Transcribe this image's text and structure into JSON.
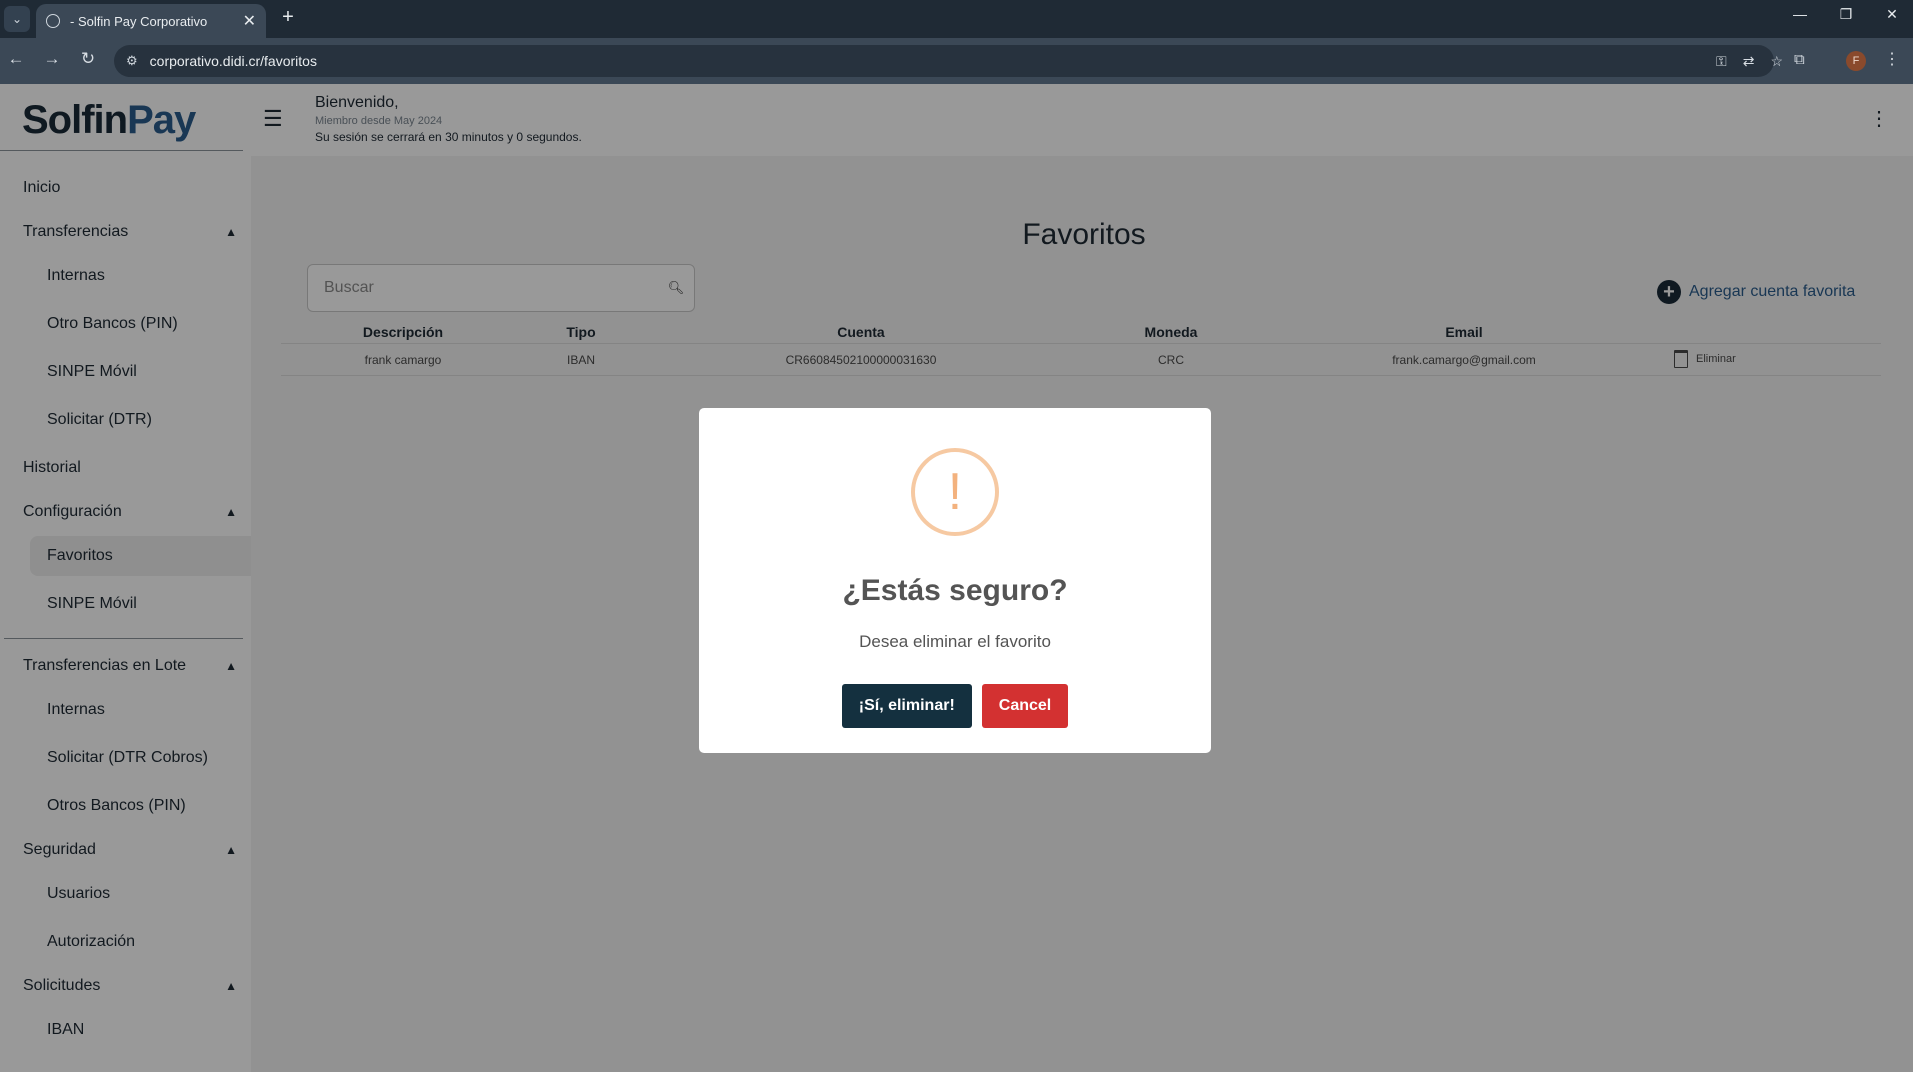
{
  "browser": {
    "tab_title": "- Solfin Pay Corporativo",
    "url": "corporativo.didi.cr/favoritos",
    "profile_initial": "F"
  },
  "app": {
    "logo_part1": "Solfin",
    "logo_part2": "Pay",
    "welcome": "Bienvenido,",
    "member_since": "Miembro desde May 2024",
    "session_notice": "Su sesión se cerrará en 30 minutos y 0 segundos."
  },
  "sidebar": {
    "items": [
      {
        "label": "Inicio"
      },
      {
        "label": "Transferencias"
      },
      {
        "label": "Internas"
      },
      {
        "label": "Otro Bancos (PIN)"
      },
      {
        "label": "SINPE Móvil"
      },
      {
        "label": "Solicitar (DTR)"
      },
      {
        "label": "Historial"
      },
      {
        "label": "Configuración"
      },
      {
        "label": "Favoritos"
      },
      {
        "label": "SINPE Móvil"
      },
      {
        "label": "Transferencias en Lote"
      },
      {
        "label": "Internas"
      },
      {
        "label": "Solicitar (DTR Cobros)"
      },
      {
        "label": "Otros Bancos (PIN)"
      },
      {
        "label": "Seguridad"
      },
      {
        "label": "Usuarios"
      },
      {
        "label": "Autorización"
      },
      {
        "label": "Solicitudes"
      },
      {
        "label": "IBAN"
      }
    ]
  },
  "main": {
    "title": "Favoritos",
    "search_placeholder": "Buscar",
    "add_label": "Agregar cuenta favorita",
    "columns": [
      "Descripción",
      "Tipo",
      "Cuenta",
      "Moneda",
      "Email"
    ],
    "rows": [
      {
        "descripcion": "frank camargo",
        "tipo": "IBAN",
        "cuenta": "CR66084502100000031630",
        "moneda": "CRC",
        "email": "frank.camargo@gmail.com",
        "action": "Eliminar"
      }
    ]
  },
  "modal": {
    "icon_text": "!",
    "title": "¿Estás seguro?",
    "text": "Desea eliminar el favorito",
    "confirm_label": "¡Sí, eliminar!",
    "cancel_label": "Cancel"
  },
  "colors": {
    "brand_dark": "#14303f",
    "brand_blue": "#2b5d8c",
    "danger": "#d33131",
    "warning": "#f3b27e"
  }
}
